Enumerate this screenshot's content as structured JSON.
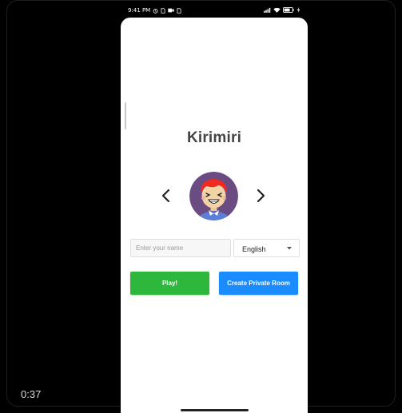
{
  "status_bar": {
    "time": "9:41 PM",
    "icons_left": [
      "alarm-icon",
      "sim-icon",
      "video-icon",
      "sim-icon"
    ],
    "icons_right": [
      "signal-icon",
      "wifi-icon",
      "battery-icon",
      "charging-icon"
    ]
  },
  "app": {
    "title": "Kirimiri",
    "name_input": {
      "placeholder": "Enter your name",
      "value": ""
    },
    "language_select": {
      "selected": "English"
    },
    "play_button": "Play!",
    "private_room_button": "Create Private Room"
  },
  "video_overlay": {
    "timer": "0:37"
  },
  "colors": {
    "play": "#2db83d",
    "private_room": "#1a8cff",
    "avatar_bg": "#6b4c82",
    "hair": "#f02a1e"
  }
}
